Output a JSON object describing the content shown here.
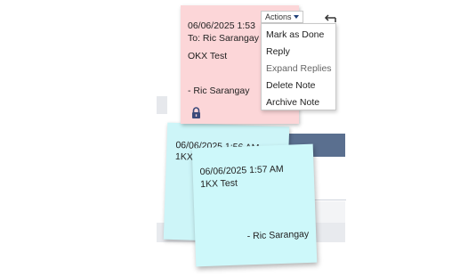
{
  "notes": {
    "pink": {
      "datetime": "06/06/2025 1:53",
      "to": "To: Ric Sarangay",
      "body": "OKX Test",
      "signature": "- Ric Sarangay",
      "color": "#fcd6d8"
    },
    "cyan_back": {
      "datetime": "06/06/2025 1:56 AM",
      "body": "1KX",
      "color": "#cdf5f8"
    },
    "cyan_front": {
      "datetime": "06/06/2025 1:57 AM",
      "body": "1KX Test",
      "signature": "- Ric Sarangay",
      "color": "#cdf8fa"
    }
  },
  "actions": {
    "label": "Actions",
    "menu": [
      {
        "label": "Mark as Done"
      },
      {
        "label": "Reply"
      },
      {
        "label": "Expand Replies"
      },
      {
        "label": "Delete Note"
      },
      {
        "label": "Archive Note"
      }
    ]
  },
  "icons": {
    "lock": "lock-icon",
    "caret": "caret-down-icon",
    "back": "back-arrow-icon"
  },
  "colors": {
    "header_navy": "#5a6f8f",
    "caret": "#1f3f77"
  }
}
